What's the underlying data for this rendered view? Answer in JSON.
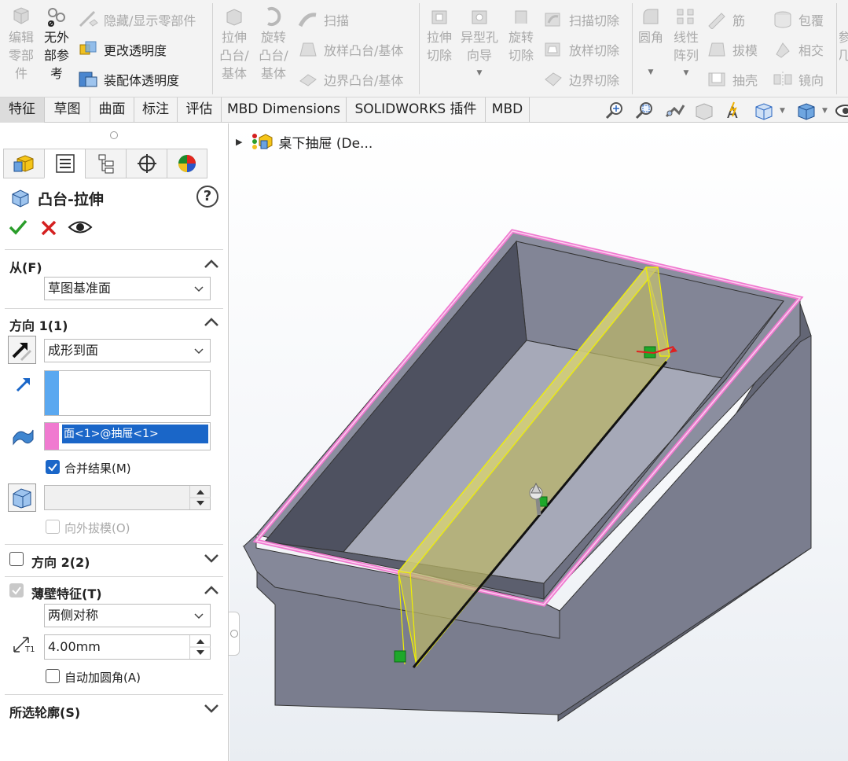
{
  "ribbon": {
    "edit_part": [
      "编辑",
      "零部",
      "件"
    ],
    "no_external_refs": [
      "无外",
      "部参",
      "考"
    ],
    "hide_show_parts": "隐藏/显示零部件",
    "change_transparency": "更改透明度",
    "assembly_transparency": "装配体透明度",
    "extrude_boss": [
      "拉伸",
      "凸台/",
      "基体"
    ],
    "revolve_boss": [
      "旋转",
      "凸台/",
      "基体"
    ],
    "sweep": "扫描",
    "loft_boss": "放样凸台/基体",
    "boundary_boss": "边界凸台/基体",
    "extrude_cut": [
      "拉伸",
      "切除"
    ],
    "hole_wizard": [
      "异型孔",
      "向导"
    ],
    "revolve_cut": [
      "旋转",
      "切除"
    ],
    "swept_cut": "扫描切除",
    "lofted_cut": "放样切除",
    "boundary_cut": "边界切除",
    "fillet": "圆角",
    "linear_pattern": [
      "线性",
      "阵列"
    ],
    "rib": "筋",
    "draft": "拔模",
    "shell": "抽壳",
    "wrap": "包覆",
    "intersect": "相交",
    "mirror": "镜向",
    "ref_geometry_partial": [
      "参",
      "几"
    ]
  },
  "tabs": [
    "特征",
    "草图",
    "曲面",
    "标注",
    "评估",
    "MBD Dimensions",
    "SOLIDWORKS 插件",
    "MBD"
  ],
  "feature_tree": {
    "root_label": "桌下抽屉 (De..."
  },
  "property_manager": {
    "title": "凸台-拉伸",
    "help": "?",
    "from_section": {
      "title": "从(F)",
      "value": "草图基准面"
    },
    "direction1": {
      "title": "方向 1(1)",
      "end_condition": "成形到面",
      "selected_face": "面<1>@抽屉<1>",
      "merge_result_label": "合并结果(M)",
      "merge_result_checked": true,
      "draft_outward_label": "向外拔模(O)"
    },
    "direction2": {
      "title": "方向 2(2)",
      "checked": false
    },
    "thin_feature": {
      "title": "薄壁特征(T)",
      "checked": true,
      "type": "两侧对称",
      "thickness": "4.00mm",
      "thickness_icon_label": "T1",
      "auto_fillet_label": "自动加圆角(A)",
      "auto_fillet_checked": false
    },
    "selected_contours": {
      "title": "所选轮廓(S)"
    }
  },
  "colors": {
    "accent_blue": "#1a66c8",
    "highlight_pink": "#f07ad0",
    "preview_yellow": "#f0f000",
    "body_gray": "#7d8090",
    "ok_green": "#2a9d2a",
    "cancel_red": "#d42020"
  }
}
